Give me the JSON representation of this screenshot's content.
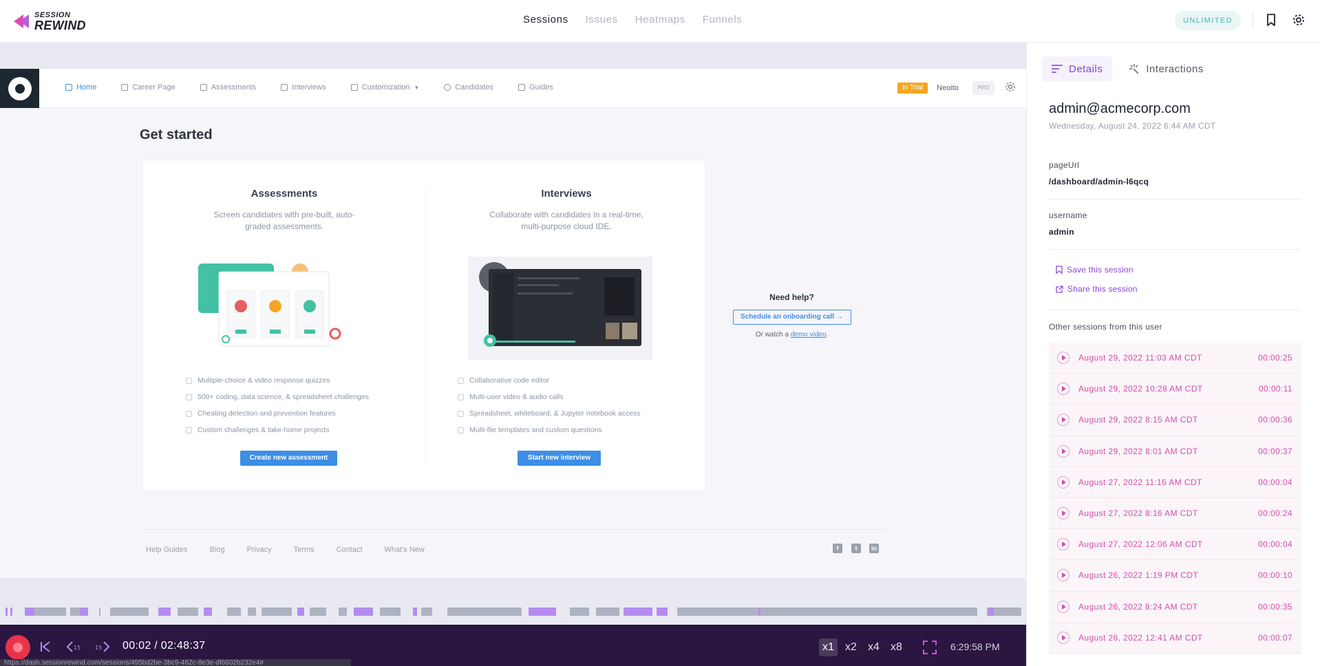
{
  "topbar": {
    "logo_line1": "SESSION",
    "logo_line2": "REWIND",
    "nav": [
      "Sessions",
      "Issues",
      "Heatmaps",
      "Funnels"
    ],
    "badge": "UNLIMITED",
    "colors": {
      "accent": "#8448d8",
      "badge_bg": "#e9f6f5",
      "badge_text": "#46b8a8"
    }
  },
  "replay": {
    "app_nav": [
      "Home",
      "Career Page",
      "Assessments",
      "Interviews",
      "Customization",
      "Candidates",
      "Guides"
    ],
    "trial_badge": "In Trial",
    "org_name": "Neoito",
    "plan_badge": "PRO",
    "page_heading": "Get started",
    "assessments": {
      "title": "Assessments",
      "desc": "Screen candidates with pre-built, auto-graded assessments.",
      "features": [
        "Multiple-choice & video response quizzes",
        "500+ coding, data science, & spreadsheet challenges",
        "Cheating detection and prevention features",
        "Custom challenges & take-home projects"
      ],
      "cta": "Create new assessment"
    },
    "interviews": {
      "title": "Interviews",
      "desc": "Collaborate with candidates in a real-time, multi-purpose cloud IDE.",
      "features": [
        "Collaborative code editor",
        "Multi-user video & audio calls",
        "Spreadsheet, whiteboard, & Jupyter notebook access",
        "Multi-file templates and custom questions"
      ],
      "cta": "Start new interview"
    },
    "help": {
      "title": "Need help?",
      "button": "Schedule an onboarding call →",
      "watch_prefix": "Or watch a ",
      "watch_link": "demo video",
      "watch_suffix": "."
    },
    "footer_links": [
      "Help Guides",
      "Blog",
      "Privacy",
      "Terms",
      "Contact",
      "What's New"
    ],
    "social": [
      "facebook-icon",
      "twitter-icon",
      "linkedin-icon"
    ]
  },
  "player": {
    "time": "00:02 / 02:48:37",
    "speeds": [
      "x1",
      "x2",
      "x4",
      "x8"
    ],
    "active_speed": "x1",
    "clock": "6:29:58 PM",
    "url_tooltip": "https://dash.sessionrewind.com/sessions/495bd2be-3bc9-462c-8e3e-df6602b232e4#"
  },
  "panel": {
    "tabs": [
      "Details",
      "Interactions"
    ],
    "email": "admin@acmecorp.com",
    "date": "Wednesday, August 24, 2022 6:44 AM CDT",
    "page_url_label": "pageUrl",
    "page_url_value": "/dashboard/admin-l6qcq",
    "username_label": "username",
    "username_value": "admin",
    "save_session": "Save this session",
    "share_session": "Share this session",
    "other_sessions_title": "Other sessions from this user",
    "sessions": [
      {
        "date": "August 29, 2022 11:03 AM CDT",
        "duration": "00:00:25"
      },
      {
        "date": "August 29, 2022 10:28 AM CDT",
        "duration": "00:00:11"
      },
      {
        "date": "August 29, 2022 8:15 AM CDT",
        "duration": "00:00:36"
      },
      {
        "date": "August 29, 2022 8:01 AM CDT",
        "duration": "00:00:37"
      },
      {
        "date": "August 27, 2022 11:16 AM CDT",
        "duration": "00:00:04"
      },
      {
        "date": "August 27, 2022 8:16 AM CDT",
        "duration": "00:00:24"
      },
      {
        "date": "August 27, 2022 12:06 AM CDT",
        "duration": "00:00:04"
      },
      {
        "date": "August 26, 2022 1:19 PM CDT",
        "duration": "00:00:10"
      },
      {
        "date": "August 26, 2022 8:24 AM CDT",
        "duration": "00:00:35"
      },
      {
        "date": "August 26, 2022 12:41 AM CDT",
        "duration": "00:00:07"
      }
    ]
  }
}
